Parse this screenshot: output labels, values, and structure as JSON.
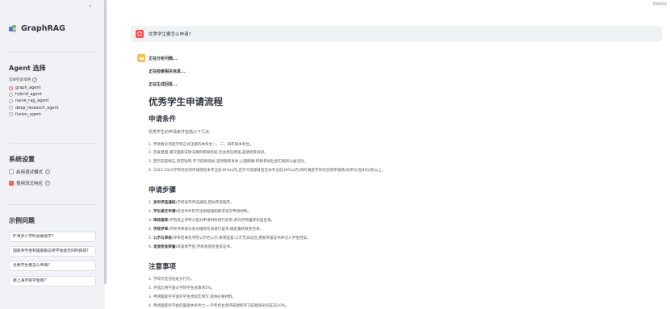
{
  "app": {
    "title": "GraphRAG",
    "deploy_label": "Deploy"
  },
  "sidebar": {
    "collapse_icon": "chevron-left-icon",
    "agent_section": {
      "title": "Agent 选择",
      "subtitle": "选择检索策略",
      "options": [
        "graph_agent",
        "hybrid_agent",
        "naive_rag_agent",
        "deep_research_agent",
        "fusion_agent"
      ],
      "selected": "graph_agent"
    },
    "system_section": {
      "title": "系统设置",
      "debug_label": "启用调试模式",
      "debug_checked": false,
      "stream_label": "使用流式响应",
      "stream_checked": true
    },
    "examples_section": {
      "title": "示例问题",
      "items": [
        "旷课多少学时会被退学?",
        "国家奖学金和国家励志奖学金能否同时获得?",
        "优秀学生要怎么申请?",
        "那上海市奖学金呢?"
      ]
    }
  },
  "chat": {
    "user_message": "优秀学生要怎么申请?",
    "status_lines": [
      "正在分析问题...",
      "正在检索相关信息...",
      "正在生成回答..."
    ],
    "answer": {
      "title": "优秀学生申请流程",
      "sections": [
        {
          "heading": "申请条件",
          "intro": "优秀学生的申请条件包括以下几点:",
          "items": [
            {
              "bold": "",
              "text": "申请者必须是学校正式注册的本科生一、二、四年级本科生。"
            },
            {
              "bold": "",
              "text": "热爱祖国,遵守国家法律法规和校规校纪,社会责任感强,品德修养良好。"
            },
            {
              "bold": "",
              "text": "西学态度端正,刻苦钻研,学习成绩优异;坚持锻炼身体,心理健康;积极参加社会实践和公益活动。"
            },
            {
              "bold": "",
              "text": "2023-2024学年综合测评成绩在本专业前30%以内,且学习成绩排名在本专业前30%以内;同时满足学年综合测评成绩(总评分)在85分及以上。"
            }
          ]
        },
        {
          "heading": "申请步骤",
          "items": [
            {
              "bold": "发布评选通知:",
              "text": "学校发布评选通知,启动评选程序。"
            },
            {
              "bold": "学生递交申请:",
              "text": "符合条件的学生根据通知要求递交申请材料。"
            },
            {
              "bold": "审核推荐:",
              "text": "学院成立评审小组对申请材料进行初审,并向学校推荐初选名单。"
            },
            {
              "bold": "学校评审:",
              "text": "学校评审委员会对推荐名单进行复审,确定最终获奖名单。"
            },
            {
              "bold": "公示与审核:",
              "text": "评审结果在学院公示栏公示,接受监督;公示无异议后,颁发荣誉证书并记入学生档案。"
            },
            {
              "bold": "发放奖金荣誉:",
              "text": "荣誉授予后,学校发放奖金及证书。"
            }
          ]
        },
        {
          "heading": "注意事项",
          "items": [
            {
              "bold": "",
              "text": "学年内无违纪处分行为。"
            },
            {
              "bold": "",
              "text": "评选比例不超过学院学生总数的5%。"
            },
            {
              "bold": "",
              "text": "申请国家奖学金的学生须如实填写,提供必要材料。"
            },
            {
              "bold": "",
              "text": "申请国家奖学金的最基本条件之一:学年综合测评成绩和学习成绩排名均在前10%。"
            }
          ]
        }
      ]
    }
  }
}
